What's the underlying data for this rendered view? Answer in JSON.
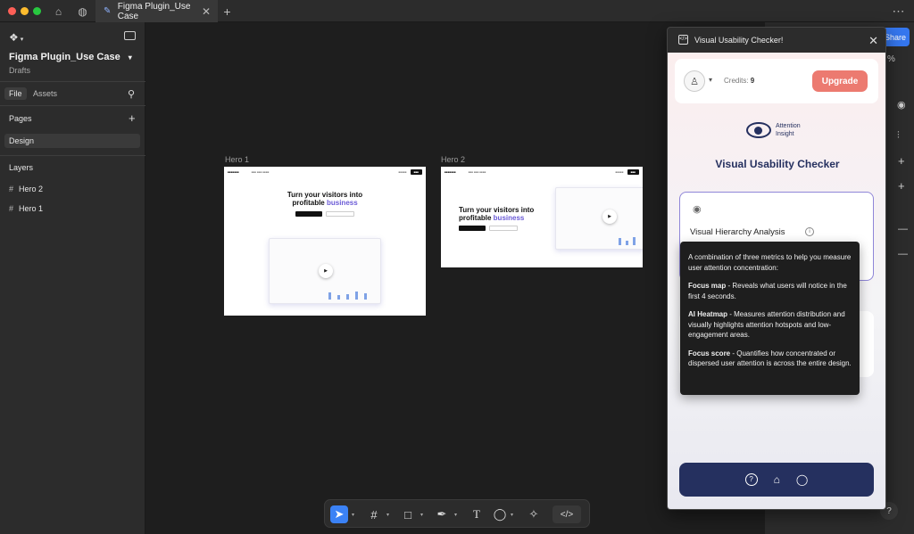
{
  "colors": {
    "accent": "#3577ef",
    "upgrade": "#ec7a70",
    "nav": "#25305f",
    "traffic_red": "#fe5f57",
    "traffic_yellow": "#febc2e",
    "traffic_green": "#28c840"
  },
  "titlebar": {
    "tab_title": "Figma Plugin_Use Case",
    "tab_close": "✕",
    "new_tab": "+",
    "more": "⋯"
  },
  "left": {
    "file_name": "Figma Plugin_Use Case",
    "location": "Drafts",
    "tabs": [
      "File",
      "Assets"
    ],
    "pages_heading": "Pages",
    "pages": [
      "Design"
    ],
    "layers_heading": "Layers",
    "layers": [
      "Hero 2",
      "Hero 1"
    ]
  },
  "canvas": {
    "frame1_label": "Hero 1",
    "frame2_label": "Hero 2",
    "hero_line1": "Turn your visitors into",
    "hero_line2a": "profitable ",
    "hero_line2b": "business",
    "play": "▶"
  },
  "right": {
    "share": "Share",
    "zoom": "%",
    "help": "?"
  },
  "plugin": {
    "title": "Visual Usability Checker!",
    "credits_label": "Credits: ",
    "credits_value": "9",
    "upgrade": "Upgrade",
    "brand_line1": "Attention",
    "brand_line2": "Insight",
    "heading": "Visual Usability Checker",
    "card_title": "Visual Hierarchy Analysis",
    "tooltip": {
      "intro": "A combination of three metrics to help you measure user attention concentration:",
      "items": [
        {
          "term": "Focus map",
          "desc": " - Reveals what users will notice in the first 4 seconds."
        },
        {
          "term": "AI Heatmap",
          "desc": " - Measures attention distribution and visually highlights attention hotspots and low-engagement areas."
        },
        {
          "term": "Focus score",
          "desc": " - Quantifies how concentrated or dispersed user attention is across the entire design."
        }
      ]
    }
  }
}
